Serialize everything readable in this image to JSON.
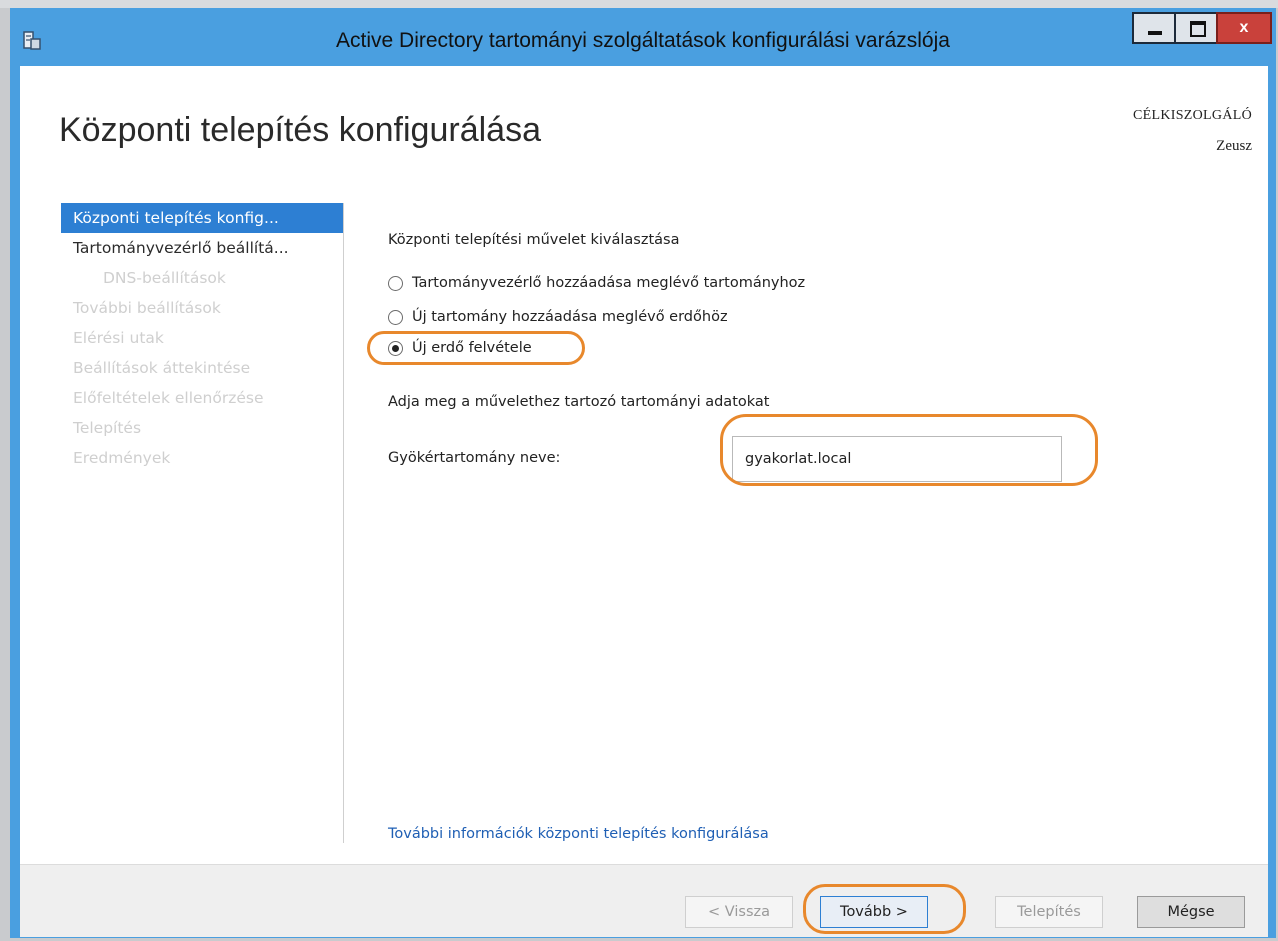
{
  "window": {
    "title": "Active Directory tartományi szolgáltatások konfigurálási varázslója",
    "close_glyph": "x",
    "icons": [
      "app-icon",
      "minimize-icon",
      "maximize-icon",
      "close-icon"
    ]
  },
  "header": {
    "page_title": "Központi telepítés konfigurálása",
    "target_label": "CÉLKISZOLGÁLÓ",
    "target_value": "Zeusz"
  },
  "nav": {
    "items": [
      {
        "label": "Központi telepítés konfig...",
        "state": "active"
      },
      {
        "label": "Tartományvezérlő beállítá...",
        "state": "enabled"
      },
      {
        "label": "DNS-beállítások",
        "state": "disabled"
      },
      {
        "label": "További beállítások",
        "state": "disabled"
      },
      {
        "label": "Elérési utak",
        "state": "disabled"
      },
      {
        "label": "Beállítások áttekintése",
        "state": "disabled"
      },
      {
        "label": "Előfeltételek ellenőrzése",
        "state": "disabled"
      },
      {
        "label": "Telepítés",
        "state": "disabled"
      },
      {
        "label": "Eredmények",
        "state": "disabled"
      }
    ]
  },
  "main": {
    "operation_heading": "Központi telepítési művelet kiválasztása",
    "options": [
      {
        "label": "Tartományvezérlő hozzáadása meglévő tartományhoz",
        "checked": false
      },
      {
        "label": "Új tartomány hozzáadása meglévő erdőhöz",
        "checked": false
      },
      {
        "label": "Új erdő felvétele",
        "checked": true
      }
    ],
    "domain_heading": "Adja meg a művelethez tartozó tartományi adatokat",
    "root_domain_label": "Gyökértartomány neve:",
    "root_domain_value": "gyakorlat.local",
    "info_link": "További információk központi telepítés konfigurálása"
  },
  "footer": {
    "back": "< Vissza",
    "next": "Tovább >",
    "install": "Telepítés",
    "cancel": "Mégse"
  },
  "colors": {
    "accent": "#2d7fd3",
    "title_bar": "#4a9fe0",
    "highlight": "#e8882c",
    "close_button": "#c9413b",
    "link": "#1f5fb4"
  }
}
